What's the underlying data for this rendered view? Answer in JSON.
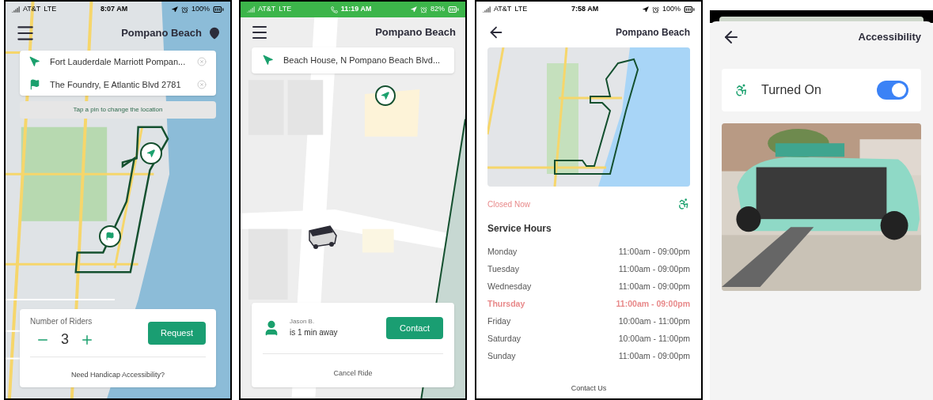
{
  "ride_request": {
    "status_bar": {
      "carrier": "AT&T",
      "network": "LTE",
      "time": "8:07 AM",
      "battery": "100%"
    },
    "title": "Pompano Beach",
    "origin": "Fort Lauderdale Marriott Pompan...",
    "destination": "The Foundry, E Atlantic Blvd 2781",
    "hint": "Tap a pin to change the location",
    "riders": {
      "label": "Number of Riders",
      "count": "3"
    },
    "request_button": "Request",
    "accessibility_link": "Need Handicap Accessibility?"
  },
  "driver_en_route": {
    "status_bar": {
      "carrier": "AT&T",
      "network": "LTE",
      "time": "11:19 AM",
      "battery": "82%"
    },
    "title": "Pompano Beach",
    "destination": "Beach House, N Pompano Beach Blvd...",
    "driver": {
      "name": "Jason B.",
      "eta": "is 1 min away"
    },
    "contact_button": "Contact",
    "cancel_button": "Cancel Ride"
  },
  "service_info": {
    "status_bar": {
      "carrier": "AT&T",
      "network": "LTE",
      "time": "7:58 AM",
      "battery": "100%"
    },
    "title": "Pompano Beach",
    "open_status": "Closed Now",
    "heading": "Service Hours",
    "hours": [
      {
        "day": "Monday",
        "hours": "11:00am - 09:00pm",
        "selected": false
      },
      {
        "day": "Tuesday",
        "hours": "11:00am - 09:00pm",
        "selected": false
      },
      {
        "day": "Wednesday",
        "hours": "11:00am - 09:00pm",
        "selected": false
      },
      {
        "day": "Thursday",
        "hours": "11:00am - 09:00pm",
        "selected": true
      },
      {
        "day": "Friday",
        "hours": "10:00am - 11:00pm",
        "selected": false
      },
      {
        "day": "Saturday",
        "hours": "10:00am - 11:00pm",
        "selected": false
      },
      {
        "day": "Sunday",
        "hours": "11:00am - 09:00pm",
        "selected": false
      }
    ],
    "contact_link": "Contact Us"
  },
  "accessibility": {
    "title": "Accessibility",
    "toggle": {
      "label": "Turned On",
      "on": true
    }
  }
}
